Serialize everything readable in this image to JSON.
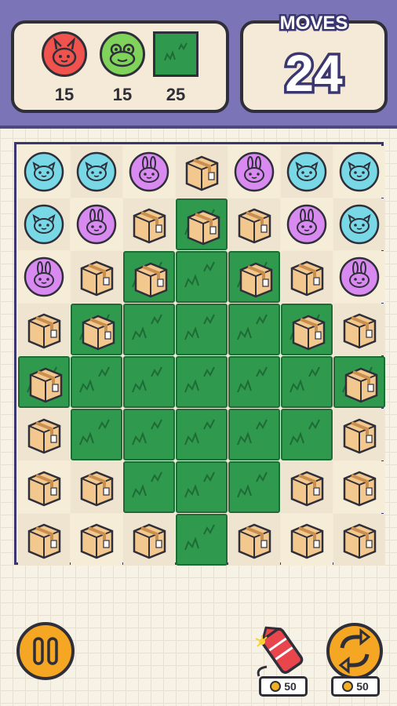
{
  "hud": {
    "goals": [
      {
        "name": "red-bunny-icon",
        "color": "#f0524d",
        "count": "15"
      },
      {
        "name": "green-frog-icon",
        "color": "#7fd35a",
        "count": "15"
      },
      {
        "name": "grass-tile-icon",
        "color": "#2f9a4e",
        "count": "25"
      }
    ],
    "moves_label": "MOVES",
    "moves_value": "24"
  },
  "board": {
    "rows": [
      [
        "cat-blue",
        "cat-blue",
        "bunny-pink",
        "box",
        "bunny-pink",
        "cat-blue",
        "cat-blue"
      ],
      [
        "cat-blue",
        "bunny-pink",
        "box",
        "box-grass",
        "box",
        "bunny-pink",
        "cat-blue"
      ],
      [
        "bunny-pink",
        "box",
        "box-grass",
        "grass",
        "box-grass",
        "box",
        "bunny-pink"
      ],
      [
        "box",
        "box-grass",
        "grass",
        "grass",
        "grass",
        "box-grass",
        "box"
      ],
      [
        "box-grass",
        "grass",
        "grass",
        "grass",
        "grass",
        "grass",
        "box-grass"
      ],
      [
        "box",
        "grass",
        "grass",
        "grass",
        "grass",
        "grass",
        "box"
      ],
      [
        "box",
        "box",
        "grass",
        "grass",
        "grass",
        "box",
        "box"
      ],
      [
        "box",
        "box",
        "box",
        "grass",
        "box",
        "box",
        "box"
      ]
    ]
  },
  "controls": {
    "pause_icon": "pause-icon",
    "rocket_price": "50",
    "shuffle_price": "50"
  },
  "colors": {
    "cat_blue": "#79d8e6",
    "bunny_pink": "#d98af0",
    "box": "#f3c88e",
    "grass": "#2f9a4e",
    "accent_orange": "#f5a623",
    "header_purple": "#7b75b8"
  }
}
